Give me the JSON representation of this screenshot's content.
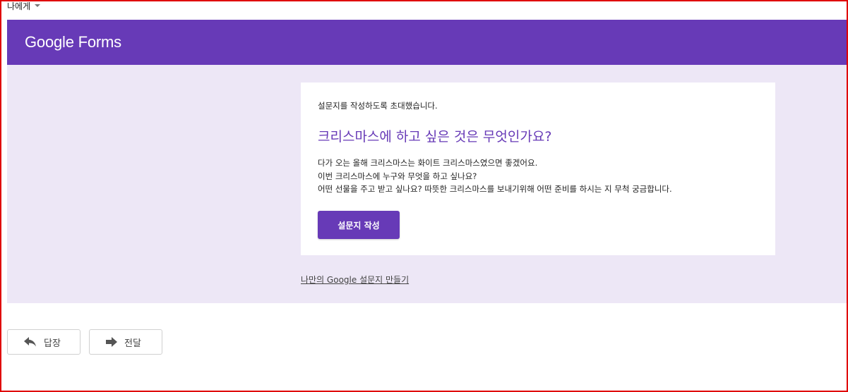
{
  "email": {
    "recipient": "나에게"
  },
  "header": {
    "logo_text": "Google Forms",
    "brand_color": "#673ab7",
    "body_background": "#ede7f6"
  },
  "card": {
    "invite_text": "설문지를 작성하도록 초대했습니다.",
    "form_title": "크리스마스에 하고 싶은 것은 무엇인가요?",
    "description_lines": [
      "다가 오는 올해 크리스마스는 화이트 크리스마스였으면 좋겠어요.",
      "이번 크리스마스에 누구와 무엇을 하고 싶나요?",
      "어떤 선물을 주고 받고 싶나요? 따뜻한 크리스마스를 보내기위해 어떤 준비를 하시는 지 무척 궁금합니다."
    ],
    "fill_button_label": "설문지 작성"
  },
  "footer_link": "나만의 Google 설문지 만들기",
  "actions": {
    "reply_label": "답장",
    "reply_icon": "reply-icon",
    "forward_label": "전달",
    "forward_icon": "forward-icon"
  }
}
